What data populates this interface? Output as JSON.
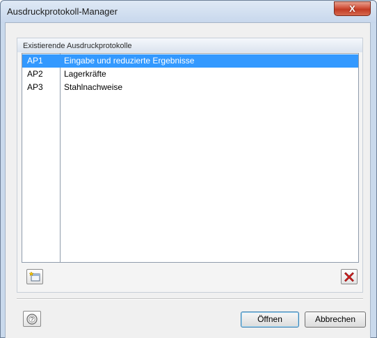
{
  "window": {
    "title": "Ausdruckprotokoll-Manager",
    "close_glyph": "X"
  },
  "group": {
    "title": "Existierende Ausdruckprotokolle"
  },
  "list": {
    "items": [
      {
        "code": "AP1",
        "name": "Eingabe und reduzierte Ergebnisse",
        "selected": true
      },
      {
        "code": "AP2",
        "name": "Lagerkräfte",
        "selected": false
      },
      {
        "code": "AP3",
        "name": "Stahlnachweise",
        "selected": false
      }
    ]
  },
  "toolbar": {
    "new_icon": "new-document-icon",
    "delete_icon": "delete-x-icon"
  },
  "footer": {
    "help_icon": "help-icon",
    "open_label": "Öffnen",
    "cancel_label": "Abbrechen"
  },
  "colors": {
    "selection": "#3399ff",
    "delete_red": "#d42020"
  }
}
